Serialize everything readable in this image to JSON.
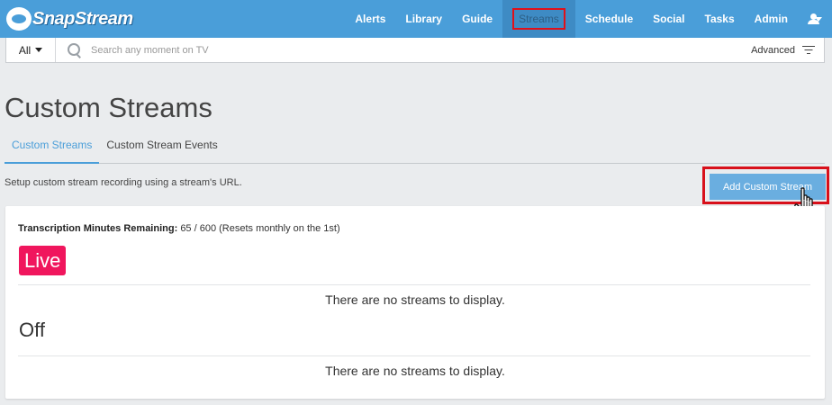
{
  "app": {
    "logo_text": "SnapStream"
  },
  "nav": {
    "items": [
      {
        "label": "Alerts"
      },
      {
        "label": "Library"
      },
      {
        "label": "Guide"
      },
      {
        "label": "Streams"
      },
      {
        "label": "Schedule"
      },
      {
        "label": "Social"
      },
      {
        "label": "Tasks"
      },
      {
        "label": "Admin"
      }
    ],
    "active": "Streams"
  },
  "search": {
    "scope": "All",
    "placeholder": "Search any moment on TV",
    "value": "",
    "advanced_label": "Advanced"
  },
  "page": {
    "title": "Custom Streams",
    "tabs": [
      {
        "label": "Custom Streams"
      },
      {
        "label": "Custom Stream Events"
      }
    ],
    "active_tab": "Custom Streams",
    "description": "Setup custom stream recording using a stream's URL.",
    "add_button_label": "Add Custom Stream"
  },
  "card": {
    "transcription_label": "Transcription Minutes Remaining:",
    "transcription_value": "65 / 600 (Resets monthly on the 1st)",
    "live_label": "Live",
    "live_empty": "There are no streams to display.",
    "off_label": "Off",
    "off_empty": "There are no streams to display."
  },
  "colors": {
    "header": "#4a9ed9",
    "accent": "#4a9ed9",
    "live_badge": "#f0165d",
    "highlight_outline": "#d8101a",
    "button": "#6aaee0"
  },
  "icons": [
    "logo-icon",
    "user-icon",
    "chevron-down-icon",
    "search-icon",
    "filter-icon",
    "hand-cursor-icon"
  ]
}
